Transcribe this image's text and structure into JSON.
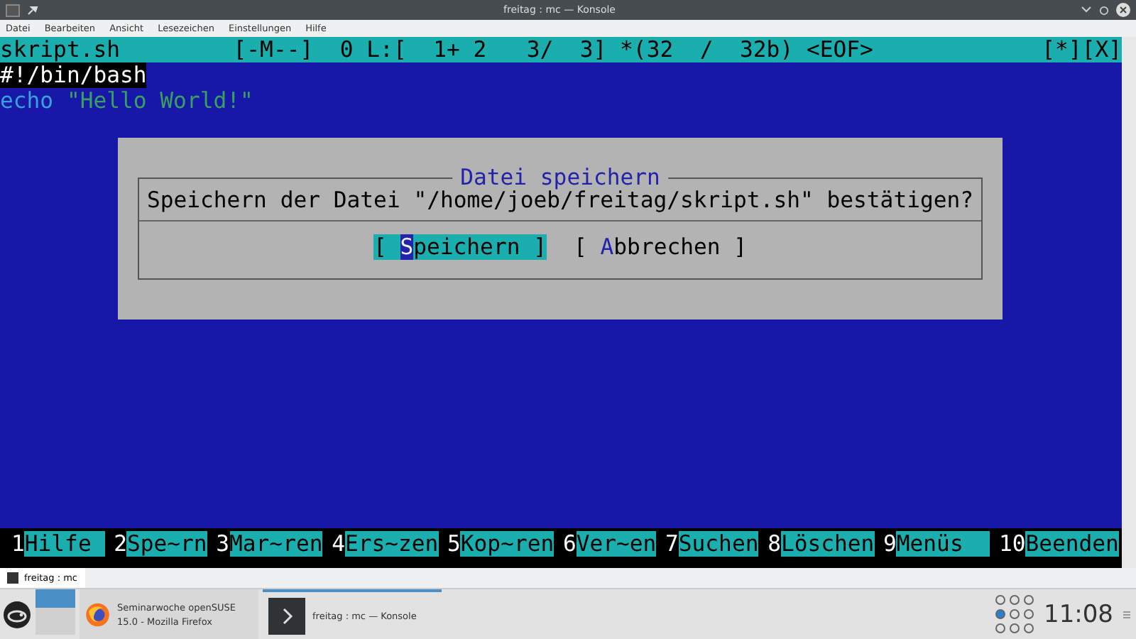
{
  "window": {
    "title": "freitag : mc — Konsole"
  },
  "menu": [
    "Datei",
    "Bearbeiten",
    "Ansicht",
    "Lesezeichen",
    "Einstellungen",
    "Hilfe"
  ],
  "editor": {
    "filename": "skript.sh",
    "status": "[-M--]  0 L:[  1+ 2   3/  3] *(32  /  32b) <EOF>",
    "flags": "[*][X]",
    "lines": [
      [
        {
          "kind": "shebang",
          "text": "#!/bin/bash"
        }
      ],
      [
        {
          "kind": "keyword",
          "text": "echo "
        },
        {
          "kind": "string",
          "text": "\"Hello World!\""
        }
      ]
    ]
  },
  "dialog": {
    "title": "Datei speichern",
    "message": "Speichern der Datei \"/home/joeb/freitag/skript.sh\" bestätigen?",
    "buttons": [
      {
        "open": "[ ",
        "hotkey": "S",
        "rest": "peichern ]",
        "selected": true
      },
      {
        "open": "[ ",
        "hotkey": "A",
        "rest": "bbrechen ]",
        "selected": false
      }
    ]
  },
  "function_keys": [
    {
      "number": "1",
      "label": "Hilfe "
    },
    {
      "number": "2",
      "label": "Spe~rn"
    },
    {
      "number": "3",
      "label": "Mar~ren"
    },
    {
      "number": "4",
      "label": "Ers~zen"
    },
    {
      "number": "5",
      "label": "Kop~ren"
    },
    {
      "number": "6",
      "label": "Ver~en"
    },
    {
      "number": "7",
      "label": "Suchen"
    },
    {
      "number": "8",
      "label": "Löschen"
    },
    {
      "number": "9",
      "label": "Menüs  "
    },
    {
      "number": "10",
      "label": "Beenden"
    }
  ],
  "session_tab": {
    "label": "freitag : mc"
  },
  "taskbar": {
    "tasks": [
      {
        "kind": "firefox",
        "label": "Seminarwoche openSUSE 15.0 - Mozilla Firefox",
        "selected": false
      },
      {
        "kind": "terminal",
        "label": "freitag : mc — Konsole",
        "selected": true
      }
    ],
    "clock": "11:08"
  }
}
